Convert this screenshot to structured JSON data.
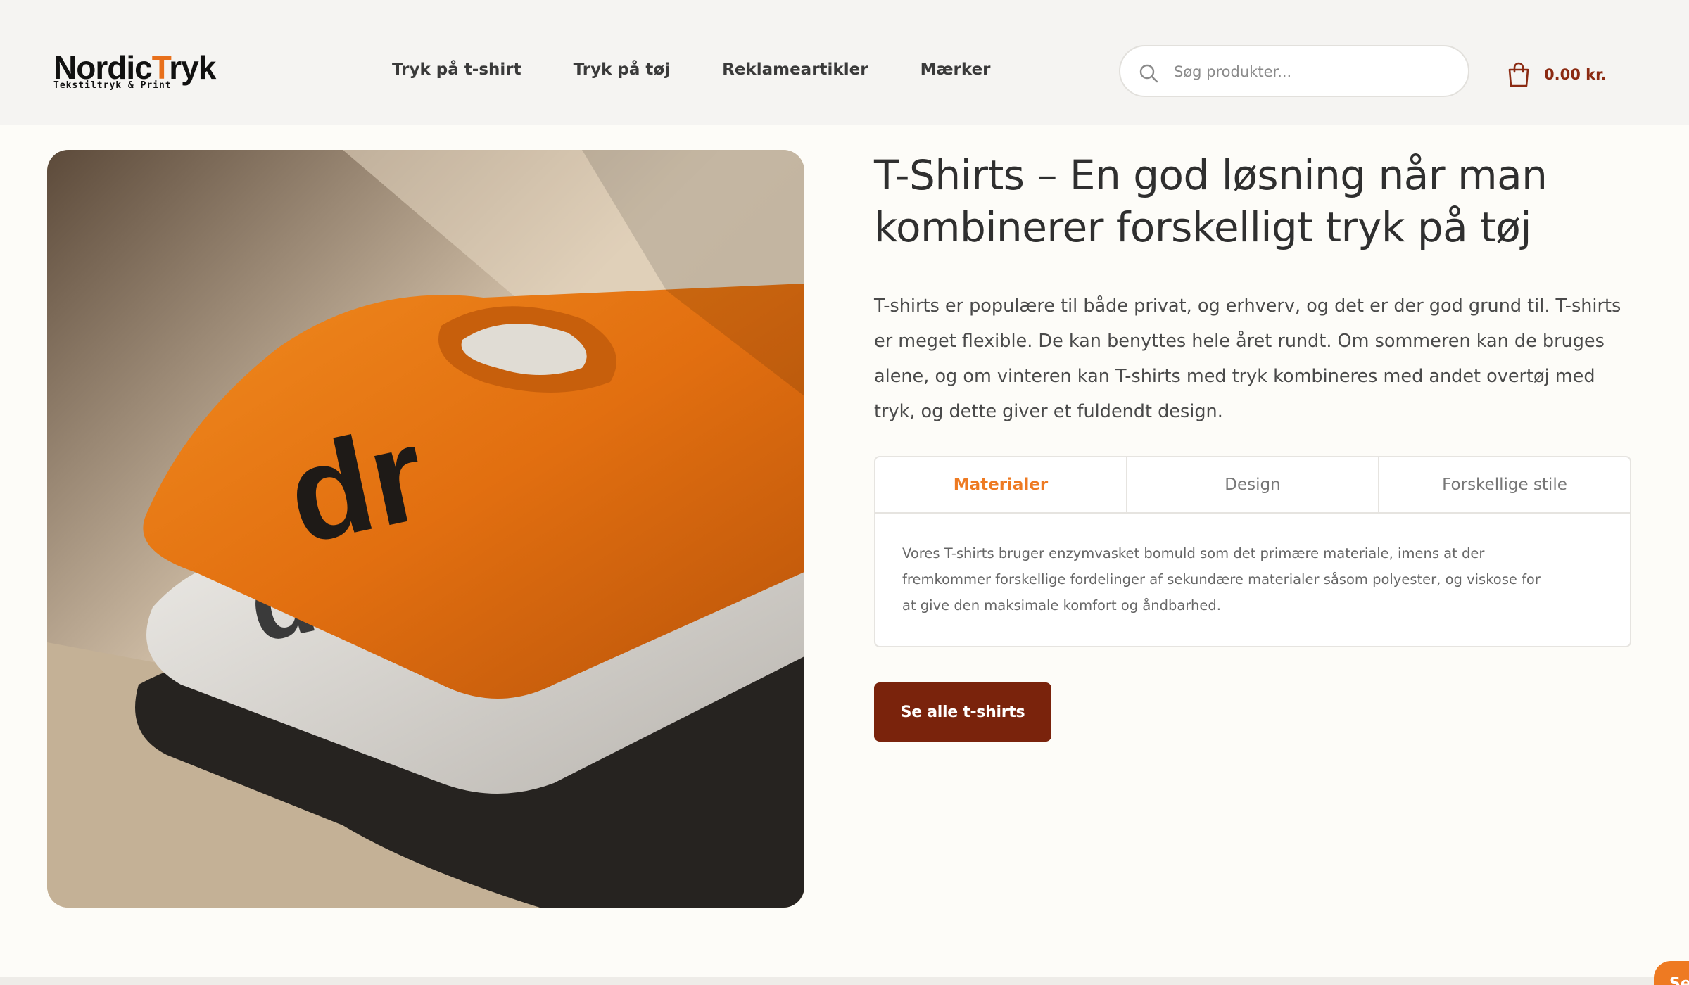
{
  "header": {
    "logo": {
      "main_a": "Nordic",
      "main_b": "T",
      "main_c": "ryk",
      "sub": "Tekstiltryk & Print"
    },
    "nav": [
      {
        "label": "Tryk på t-shirt"
      },
      {
        "label": "Tryk på tøj"
      },
      {
        "label": "Reklameartikler"
      },
      {
        "label": "Mærker"
      }
    ],
    "search": {
      "placeholder": "Søg produkter...",
      "value": ""
    },
    "cart": {
      "total": "0.00 kr."
    }
  },
  "main": {
    "image": {
      "alt": ""
    },
    "title": "T-Shirts – En god løsning når man kombinerer forskelligt tryk på tøj",
    "intro": "T-shirts er populære til både privat, og erhverv, og det er der god grund til. T-shirts er meget flexible. De kan benyttes hele året rundt. Om sommeren kan de bruges alene, og om vinteren kan T-shirts med tryk kombineres med andet overtøj med tryk, og dette giver et fuldendt design.",
    "tabs": [
      {
        "label": "Materialer",
        "active": true
      },
      {
        "label": "Design",
        "active": false
      },
      {
        "label": "Forskellige stile",
        "active": false
      }
    ],
    "tab_content": "Vores T-shirts bruger enzymvasket bomuld som det primære materiale, imens at der fremkommer forskellige fordelinger af sekundære materialer såsom polyester, og viskose for at give den maksimale komfort og åndbarhed.",
    "cta_label": "Se alle t-shirts"
  },
  "chat": {
    "label": "Se"
  },
  "colors": {
    "accent": "#ee7a22",
    "brand_dark": "#7a230c",
    "cart_text": "#8b2a12",
    "header_bg": "#f5f4f2",
    "page_bg": "#fdfcf8"
  },
  "icons": {
    "search": "search-icon",
    "cart": "shopping-bag-icon"
  }
}
